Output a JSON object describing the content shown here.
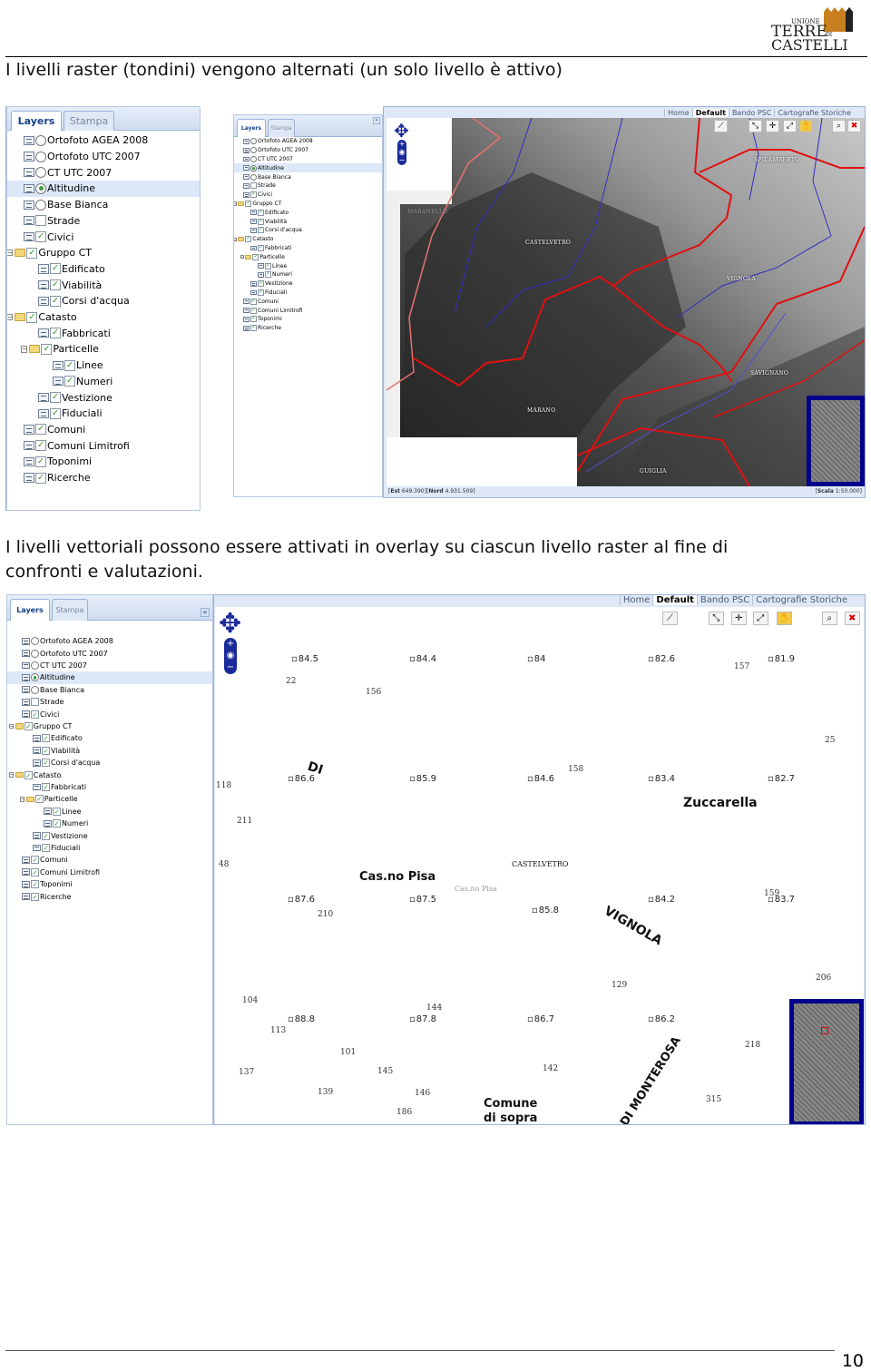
{
  "logo": {
    "line1": "UNIONE",
    "line2": "TERRE DI",
    "line3": "CASTELLI",
    "brand_color": "#c8801e"
  },
  "heading1": "I livelli raster (tondini) vengono alternati (un solo livello è attivo)",
  "heading2_line1": "I livelli vettoriali possono essere attivati in overlay su ciascun livello  raster al fine di",
  "heading2_line2": "confronti e valutazioni.",
  "panel_tabs": {
    "layers": "Layers",
    "stampa": "Stampa"
  },
  "layers": [
    {
      "label": "Ortofoto AGEA 2008",
      "type": "radio",
      "checked": false,
      "level": 0
    },
    {
      "label": "Ortofoto UTC 2007",
      "type": "radio",
      "checked": false,
      "level": 0
    },
    {
      "label": "CT UTC 2007",
      "type": "radio",
      "checked": false,
      "level": 0
    },
    {
      "label": "Altitudine",
      "type": "radio",
      "checked": true,
      "level": 0,
      "selected": true
    },
    {
      "label": "Base Bianca",
      "type": "radio",
      "checked": false,
      "level": 0
    },
    {
      "label": "Strade",
      "type": "check",
      "checked": false,
      "level": 0
    },
    {
      "label": "Civici",
      "type": "check",
      "checked": true,
      "level": 0
    },
    {
      "label": "Gruppo CT",
      "type": "check",
      "checked": true,
      "level": 0,
      "folder": true
    },
    {
      "label": "Edificato",
      "type": "check",
      "checked": true,
      "level": 1
    },
    {
      "label": "Viabilità",
      "type": "check",
      "checked": true,
      "level": 1
    },
    {
      "label": "Corsi d'acqua",
      "type": "check",
      "checked": true,
      "level": 1
    },
    {
      "label": "Catasto",
      "type": "check",
      "checked": true,
      "level": 0,
      "folder": true
    },
    {
      "label": "Fabbricati",
      "type": "check",
      "checked": true,
      "level": 1
    },
    {
      "label": "Particelle",
      "type": "check",
      "checked": true,
      "level": 1,
      "folder": true
    },
    {
      "label": "Linee",
      "type": "check",
      "checked": true,
      "level": 2
    },
    {
      "label": "Numeri",
      "type": "check",
      "checked": true,
      "level": 2
    },
    {
      "label": "Vestizione",
      "type": "check",
      "checked": true,
      "level": 1
    },
    {
      "label": "Fiduciali",
      "type": "check",
      "checked": true,
      "level": 1
    },
    {
      "label": "Comuni",
      "type": "check",
      "checked": true,
      "level": 0
    },
    {
      "label": "Comuni Limitrofi",
      "type": "check",
      "checked": true,
      "level": 0
    },
    {
      "label": "Toponimi",
      "type": "check",
      "checked": true,
      "level": 0
    },
    {
      "label": "Ricerche",
      "type": "check",
      "checked": true,
      "level": 0
    }
  ],
  "map_tabs": [
    "Home",
    "Default",
    "Bando PSC",
    "Cartografie Storiche"
  ],
  "map_tabs_active": "Default",
  "status": {
    "est_label": "Est",
    "est": "649.390",
    "nord_label": "Nord",
    "nord": "4.931.509",
    "scala_label": "Scala",
    "scala": "1:50.000"
  },
  "map1_labels": [
    "SPILAMBERTO",
    "MARANELLO",
    "CASTELVETRO",
    "VIGNOLA",
    "SAVIGNANO",
    "MARANO",
    "GUIGLIA"
  ],
  "map2": {
    "elevations": [
      "84.5",
      "84.4",
      "84",
      "82.6",
      "81.9",
      "86.6",
      "85.9",
      "84.6",
      "83.4",
      "82.7",
      "87.6",
      "87.5",
      "85.8",
      "84.2",
      "83.7",
      "88.8",
      "87.8",
      "86.7",
      "86.2"
    ],
    "parcels": [
      "22",
      "156",
      "157",
      "25",
      "158",
      "118",
      "211",
      "48",
      "210",
      "129",
      "206",
      "104",
      "144",
      "113",
      "137",
      "142",
      "139",
      "315",
      "159",
      "101",
      "145",
      "146",
      "186",
      "218"
    ],
    "names": {
      "di": "DI",
      "zuccarella": "Zuccarella",
      "casno_pisa": "Cas.no Pisa",
      "castelvetro": "CASTELVETRO",
      "casno_pisa_small": "Cas.no Pisa",
      "vignola": "VIGNOLA",
      "monterosa": "DI MONTEROSA",
      "comune1": "Comune",
      "comune2": "di sopra"
    }
  },
  "colors": {
    "boundary": "#e01010",
    "river": "#3030c0",
    "overview": "#00008b",
    "panel_header": "#dfe8f6"
  },
  "page_number": "10"
}
